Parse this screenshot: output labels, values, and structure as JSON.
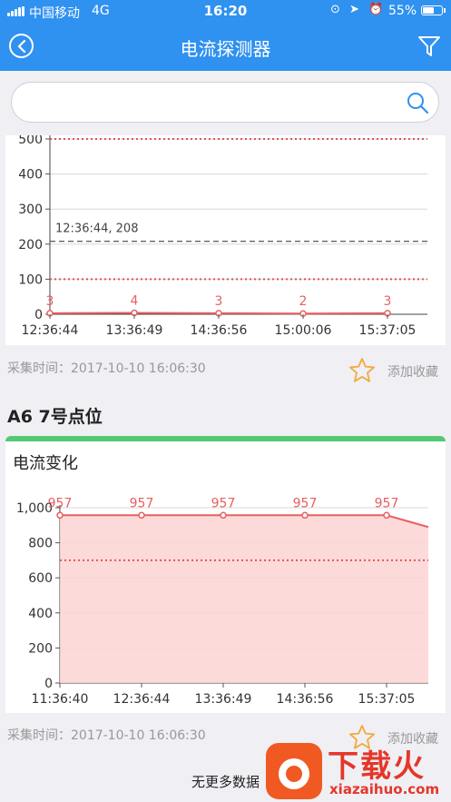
{
  "status_bar": {
    "carrier": "中国移动",
    "network": "4G",
    "time": "16:20",
    "icons": [
      "lock-rotation-icon",
      "location-icon",
      "alarm-icon"
    ],
    "battery": "55%",
    "battery_level": 0.55
  },
  "header": {
    "title": "电流探测器",
    "back_icon": "back-circle-icon",
    "filter_icon": "filter-funnel-icon",
    "bg_color": "#2f91f0"
  },
  "search": {
    "placeholder": "",
    "value": "",
    "icon": "search-icon"
  },
  "cards": [
    {
      "meta": "采集时间：2017-10-10 16:06:30",
      "favorite_label": "添加收藏",
      "favorite_icon": "star-outline-icon"
    },
    {
      "point_title": "A6 7号点位",
      "title": "电流变化",
      "meta": "采集时间：2017-10-10 16:06:30",
      "favorite_label": "添加收藏",
      "favorite_icon": "star-outline-icon",
      "accent_color": "#54c873"
    }
  ],
  "footer": {
    "text": "无更多数据"
  },
  "watermark": {
    "text": "下载火",
    "url": "xiazaihuo.com"
  },
  "chart_data": [
    {
      "type": "line",
      "x": [
        "12:36:44",
        "13:36:49",
        "14:36:56",
        "15:00:06",
        "15:37:05"
      ],
      "values": [
        3,
        4,
        3,
        2,
        3
      ],
      "data_labels": [
        "3",
        "4",
        "3",
        "2",
        "3"
      ],
      "yticks": [
        0,
        100,
        200,
        300,
        400,
        500
      ],
      "ylim": [
        0,
        500
      ],
      "limit_lines": [
        500,
        100
      ],
      "reference_line": {
        "value": 208,
        "label": "12:36:44, 208"
      },
      "line_color": "#e86060",
      "grid": true
    },
    {
      "type": "area",
      "x": [
        "11:36:40",
        "12:36:44",
        "13:36:49",
        "14:36:56",
        "15:37:05"
      ],
      "values": [
        957,
        957,
        957,
        957,
        957,
        890
      ],
      "data_labels": [
        "957",
        "957",
        "957",
        "957",
        "957"
      ],
      "yticks": [
        "0",
        "200",
        "400",
        "600",
        "800",
        "1,000"
      ],
      "ylim": [
        0,
        1000
      ],
      "limit_lines": [
        700
      ],
      "line_color": "#e86060",
      "fill_color": "#fbd3d3",
      "grid": true
    }
  ]
}
